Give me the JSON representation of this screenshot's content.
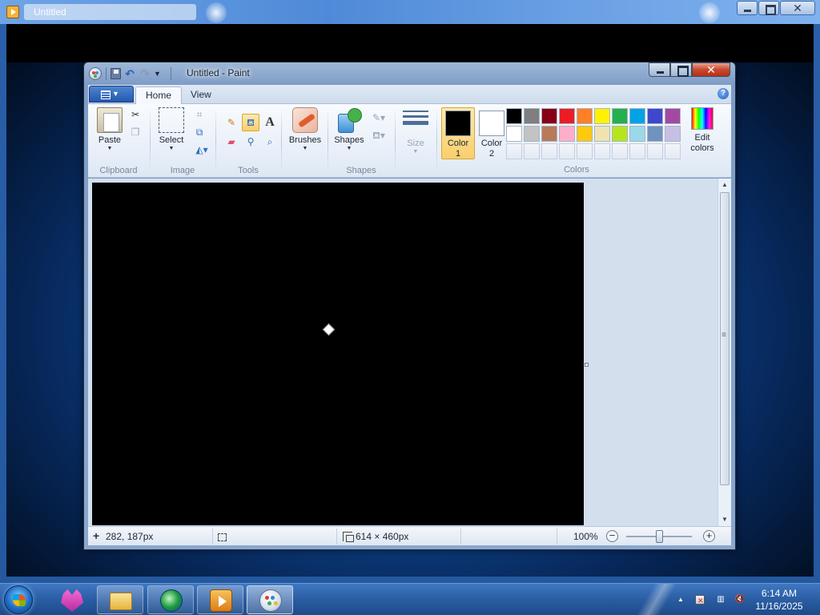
{
  "outer_window": {
    "title": "Untitled"
  },
  "paint": {
    "title": "Untitled - Paint",
    "tabs": [
      {
        "label": "Home"
      },
      {
        "label": "View"
      }
    ],
    "groups": {
      "clipboard": {
        "label": "Clipboard",
        "paste": "Paste"
      },
      "image": {
        "label": "Image",
        "select": "Select"
      },
      "tools": {
        "label": "Tools"
      },
      "shapes": {
        "label": "Shapes",
        "brushes": "Brushes",
        "shapes": "Shapes"
      },
      "size": {
        "label": "Size"
      },
      "colors": {
        "label": "Colors",
        "color1_line1": "Color",
        "color1_line2": "1",
        "color2_line1": "Color",
        "color2_line2": "2",
        "edit_line1": "Edit",
        "edit_line2": "colors",
        "color1_value": "#000000",
        "color2_value": "#ffffff",
        "palette_row1": [
          "#000000",
          "#7f7f7f",
          "#880015",
          "#ed1c24",
          "#ff7f27",
          "#fff200",
          "#22b14c",
          "#00a2e8",
          "#3f48cc",
          "#a349a4"
        ],
        "palette_row2": [
          "#ffffff",
          "#c3c3c3",
          "#b97a57",
          "#ffaec9",
          "#ffc90e",
          "#efe4b0",
          "#b5e61d",
          "#99d9ea",
          "#7092be",
          "#c8bfe7"
        ]
      }
    },
    "canvas": {
      "background": "#000000"
    },
    "status": {
      "cursor_pos": "282, 187px",
      "image_size": "614 × 460px",
      "zoom": "100%"
    }
  },
  "taskbar": {
    "time": "6:14 AM",
    "date": "11/16/2025"
  }
}
